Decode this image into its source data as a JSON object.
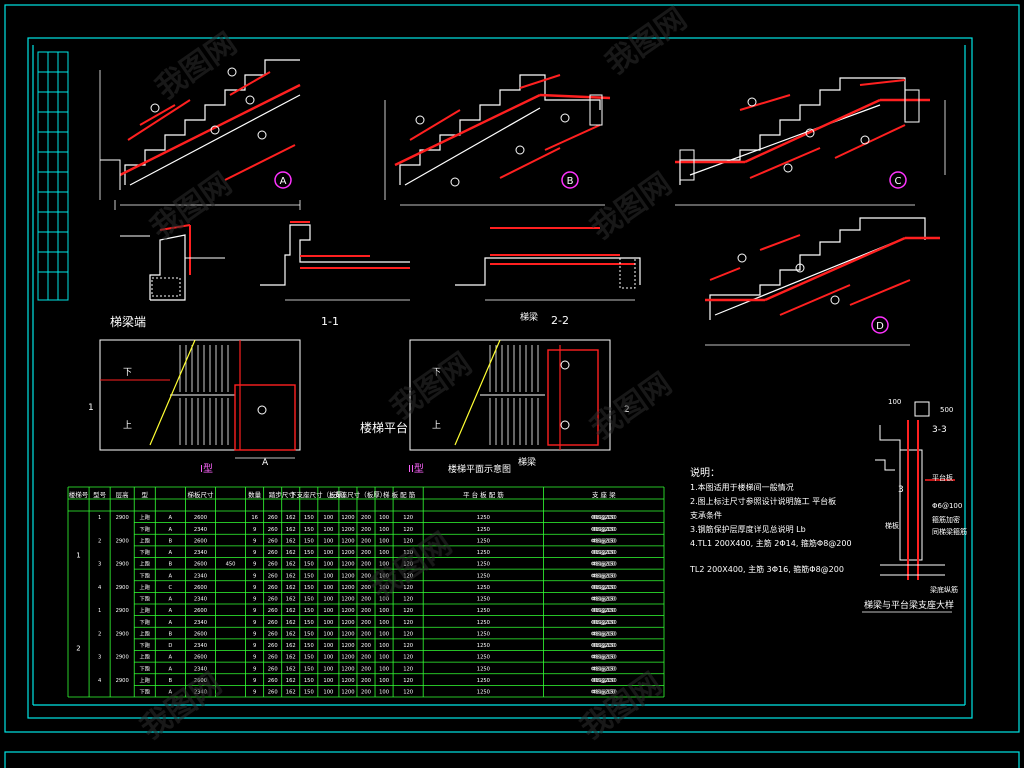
{
  "drawing": {
    "sheet_labels": {
      "section_1": "1-1",
      "section_2": "2-2",
      "section_3": "3-3",
      "plan_label": "梯梁端",
      "platform_label": "楼梯平面示意图",
      "platform_text": "楼梯平台",
      "stair_table_label": "梯梁 平 台 平面布置",
      "beam_label": "梯梁",
      "detail_caption": "梯梁与平台梁支座大样"
    },
    "stair_types": [
      "A",
      "B",
      "C",
      "D"
    ],
    "plan_marks": {
      "up": "上",
      "down": "下",
      "axis_1": "1",
      "axis_2": "2",
      "axis_A": "A",
      "tag_1": "I型",
      "tag_2": "II型"
    },
    "notes": {
      "title": "说明：",
      "lines": [
        "1.本图适用于楼梯间一般情况",
        "2.图上标注尺寸参照设计说明施工        平台板",
        "  支承条件",
        "3.钢筋保护层厚度详见总说明              Lb",
        "4.TL1  200X400,    主筋  2Φ14,   箍筋Φ8@200",
        "  TL2  200X400,    主筋  3Φ16,   箍筋Φ8@200"
      ]
    },
    "table": {
      "headers": [
        "楼梯号",
        "型号",
        "层高",
        "型",
        "梯板尺寸",
        "数量",
        "踏步尺寸",
        "下支座尺寸（板厚）",
        "上支座尺寸（板厚）",
        "梯 板 配 筋",
        "平 台 板 配 筋",
        "支 座 梁"
      ],
      "group_labels": [
        "1",
        "2"
      ],
      "rows": [
        [
          "1",
          "2900",
          "上跑",
          "A",
          "2600",
          "",
          "16",
          "260",
          "162",
          "150",
          "100",
          "1200",
          "200",
          "100",
          "120",
          "1250",
          "Φ10@150",
          "Φ8@200"
        ],
        [
          "",
          "",
          "下跑",
          "A",
          "2340",
          "",
          "9",
          "260",
          "162",
          "150",
          "100",
          "1200",
          "200",
          "100",
          "120",
          "1250",
          "Φ10@150",
          "Φ8@200"
        ],
        [
          "2",
          "2900",
          "上跑",
          "B",
          "2600",
          "",
          "9",
          "260",
          "162",
          "150",
          "100",
          "1200",
          "200",
          "100",
          "120",
          "1250",
          "Φ10@150",
          "Φ8@200"
        ],
        [
          "",
          "",
          "下跑",
          "A",
          "2340",
          "",
          "9",
          "260",
          "162",
          "150",
          "100",
          "1200",
          "200",
          "100",
          "120",
          "1250",
          "Φ10@150",
          "Φ8@200"
        ],
        [
          "3",
          "2900",
          "上跑",
          "B",
          "2600",
          "450",
          "9",
          "260",
          "162",
          "150",
          "100",
          "1200",
          "200",
          "100",
          "120",
          "1250",
          "Φ10@150",
          "Φ8@200"
        ],
        [
          "",
          "",
          "下跑",
          "A",
          "2340",
          "",
          "9",
          "260",
          "162",
          "150",
          "100",
          "1200",
          "200",
          "100",
          "120",
          "1250",
          "Φ10@150",
          "Φ8@200"
        ],
        [
          "4",
          "2900",
          "上跑",
          "C",
          "2600",
          "",
          "9",
          "260",
          "162",
          "150",
          "100",
          "1200",
          "200",
          "100",
          "120",
          "1250",
          "Φ10@150",
          "Φ8@200"
        ],
        [
          "",
          "",
          "下跑",
          "A",
          "2340",
          "",
          "9",
          "260",
          "162",
          "150",
          "100",
          "1200",
          "200",
          "100",
          "120",
          "1250",
          "Φ10@150",
          "Φ8@200"
        ],
        [
          "1",
          "2900",
          "上跑",
          "A",
          "2600",
          "",
          "9",
          "260",
          "162",
          "150",
          "100",
          "1200",
          "200",
          "100",
          "120",
          "1250",
          "Φ10@150",
          "Φ8@200"
        ],
        [
          "",
          "",
          "下跑",
          "A",
          "2340",
          "",
          "9",
          "260",
          "162",
          "150",
          "100",
          "1200",
          "200",
          "100",
          "120",
          "1250",
          "Φ10@150",
          "Φ8@200"
        ],
        [
          "2",
          "2900",
          "上跑",
          "B",
          "2600",
          "",
          "9",
          "260",
          "162",
          "150",
          "100",
          "1200",
          "200",
          "100",
          "120",
          "1250",
          "Φ10@150",
          "Φ8@200"
        ],
        [
          "",
          "",
          "下跑",
          "D",
          "2340",
          "",
          "9",
          "260",
          "162",
          "150",
          "100",
          "1200",
          "200",
          "100",
          "120",
          "1250",
          "Φ10@150",
          "Φ8@200"
        ],
        [
          "3",
          "2900",
          "上跑",
          "A",
          "2600",
          "",
          "9",
          "260",
          "162",
          "150",
          "100",
          "1200",
          "200",
          "100",
          "120",
          "1250",
          "Φ10@150",
          "Φ8@200"
        ],
        [
          "",
          "",
          "下跑",
          "A",
          "2340",
          "",
          "9",
          "260",
          "162",
          "150",
          "100",
          "1200",
          "200",
          "100",
          "120",
          "1250",
          "Φ10@150",
          "Φ8@200"
        ],
        [
          "4",
          "2900",
          "上跑",
          "B",
          "2600",
          "",
          "9",
          "260",
          "162",
          "150",
          "100",
          "1200",
          "200",
          "100",
          "120",
          "1250",
          "Φ10@150",
          "Φ8@200"
        ],
        [
          "",
          "",
          "下跑",
          "A",
          "2340",
          "",
          "9",
          "260",
          "162",
          "150",
          "100",
          "1200",
          "200",
          "100",
          "120",
          "1250",
          "Φ10@150",
          "Φ8@200"
        ]
      ]
    },
    "detail_marks": {
      "plate": "平台板",
      "cut": "3",
      "labels": [
        "Φ6@100",
        "梯板",
        "箍筋加密",
        "同梯梁箍筋",
        "梁底纵筋"
      ],
      "dims": [
        "100",
        "500"
      ]
    },
    "watermark": "我图网",
    "colors": {
      "background": "#000000",
      "frame": "#00ffff",
      "linework": "#ffffff",
      "rebar": "#ff2020",
      "table": "#33ff33",
      "text_yellow": "#ffff33",
      "marker": "#ff33ff"
    }
  }
}
